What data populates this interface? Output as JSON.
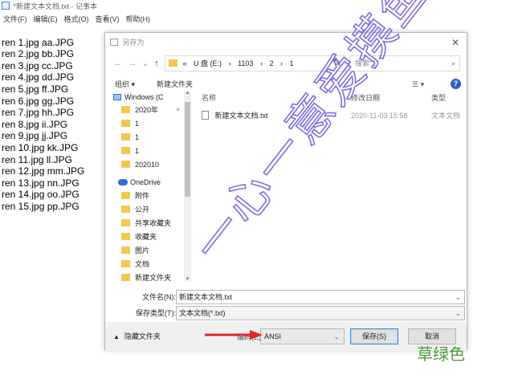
{
  "notepad": {
    "title": "*新建文本文档.txt - 记事本",
    "menu": [
      "文件(F)",
      "编辑(E)",
      "格式(O)",
      "查看(V)",
      "帮助(H)"
    ],
    "lines": [
      "ren 1.jpg aa.JPG",
      "ren 2.jpg bb.JPG",
      "ren 3.jpg cc.JPG",
      "ren 4.jpg dd.JPG",
      "ren 5.jpg ff.JPG",
      "ren 6.jpg gg.JPG",
      "ren 7.jpg hh.JPG",
      "ren 8.jpg ii.JPG",
      "ren 9.jpg jj.JPG",
      "ren 10.jpg kk.JPG",
      "ren 11.jpg ll.JPG",
      "ren 12.jpg mm.JPG",
      "ren 13.jpg nn.JPG",
      "ren 14.jpg oo.JPG",
      "ren 15.jpg pp.JPG"
    ]
  },
  "dialog": {
    "title": "另存为",
    "close": "✕",
    "address": {
      "prefix": "«",
      "crumbs": [
        "U 盘 (E:)",
        "›",
        "1103",
        "›",
        "2",
        "›",
        "1"
      ],
      "search_placeholder": "搜索\"1\""
    },
    "toolbar": {
      "organize": "组织 ▾",
      "new_folder": "新建文件夹",
      "view": "☰ ▾",
      "help": "?"
    },
    "nav": {
      "items": [
        {
          "label": "Windows (C",
          "kind": "pc"
        },
        {
          "label": "2020年",
          "kind": "folder",
          "pin": "📌"
        },
        {
          "label": "1",
          "kind": "folder"
        },
        {
          "label": "1",
          "kind": "folder"
        },
        {
          "label": "1",
          "kind": "folder"
        },
        {
          "label": "202010",
          "kind": "folder"
        },
        {
          "label": "OneDrive",
          "kind": "cloud"
        },
        {
          "label": "附件",
          "kind": "folder"
        },
        {
          "label": "公开",
          "kind": "folder"
        },
        {
          "label": "共享收藏夹",
          "kind": "folder"
        },
        {
          "label": "收藏夹",
          "kind": "folder"
        },
        {
          "label": "图片",
          "kind": "folder"
        },
        {
          "label": "文档",
          "kind": "folder"
        },
        {
          "label": "新建文件夹",
          "kind": "folder"
        }
      ]
    },
    "columns": {
      "name": "名称",
      "modified": "修改日期",
      "type": "类型"
    },
    "files": [
      {
        "name": "新建文本文档.txt",
        "modified": "2020-11-03 15:58",
        "type": "文本文档"
      }
    ],
    "filename_label": "文件名(N):",
    "filename_value": "新建文本文档.txt",
    "savetype_label": "保存类型(T):",
    "savetype_value": "文本文档(*.txt)",
    "hide_folders": "隐藏文件夹",
    "encoding_label": "编码(E):",
    "encoding_value": "ANSI",
    "save_button": "保存(S)",
    "cancel_button": "取消"
  },
  "watermark": {
    "text": "一心一意爱摸鱼",
    "color": "#7b6fe0"
  },
  "corner_label": "草绿色",
  "colors": {
    "arrow": "#e0262a",
    "corner": "#4d9b3a",
    "accent": "#2a62c8"
  }
}
